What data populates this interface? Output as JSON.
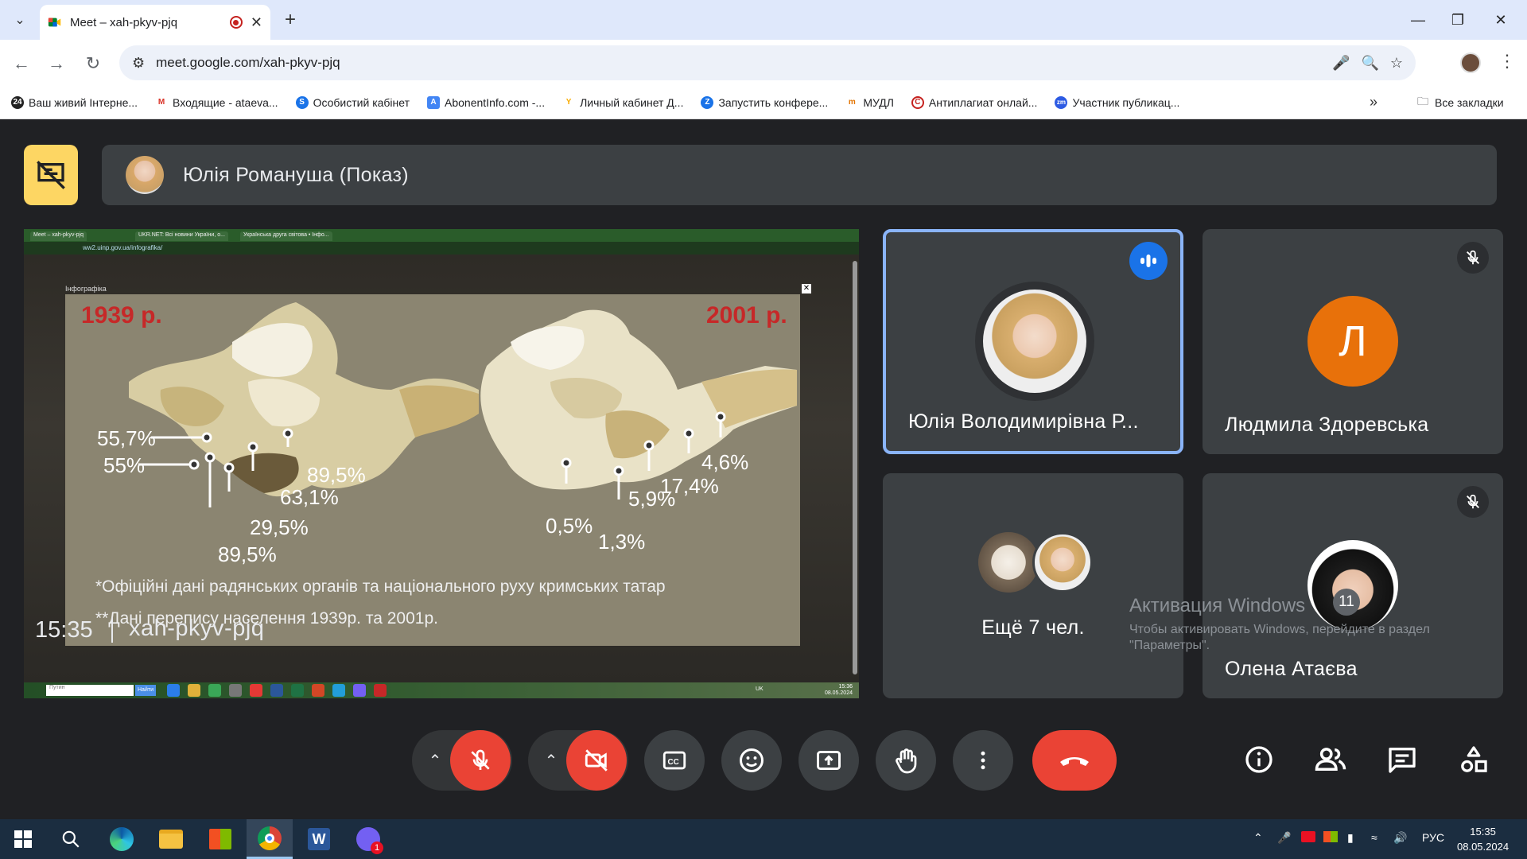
{
  "browser": {
    "tab_title": "Meet – xah-pkyv-pjq",
    "url": "meet.google.com/xah-pkyv-pjq",
    "new_tab_symbol": "+",
    "window_controls": [
      "minimize",
      "restore",
      "close"
    ]
  },
  "bookmarks": [
    {
      "label": "Ваш живий Інтерне...",
      "color": "#222",
      "glyph": "24"
    },
    {
      "label": "Входящие - ataeva...",
      "color": "#d93025",
      "glyph": "M"
    },
    {
      "label": "Особистий кабінет",
      "color": "#1a73e8",
      "glyph": "S"
    },
    {
      "label": "AbonentInfo.com -...",
      "color": "#4285f4",
      "glyph": "A"
    },
    {
      "label": "Личный кабинет Д...",
      "color": "#f9ab00",
      "glyph": "Y"
    },
    {
      "label": "Запустить конфере...",
      "color": "#1a73e8",
      "glyph": "Z"
    },
    {
      "label": "МУДЛ",
      "color": "#e37400",
      "glyph": "m"
    },
    {
      "label": "Антиплагиат онлай...",
      "color": "#c5221f",
      "glyph": "C"
    },
    {
      "label": "Участник публикац...",
      "color": "#2d5be3",
      "glyph": "zm"
    }
  ],
  "bookmarks_all": "Все закладки",
  "presenter": {
    "name": "Юлія Романуша (Показ)"
  },
  "shared_screen": {
    "inner_tabs": [
      "Meet – xah-pkyv-pjq",
      "UKR.NET: Всі новини України, о...",
      "Українська друга світова • Інфо..."
    ],
    "inner_url": "ww2.uinp.gov.ua/infografika/",
    "infographic_label": "Інфографіка",
    "year_left": "1939 р.",
    "year_right": "2001 р.",
    "left_values": [
      "55,7%",
      "55%",
      "89,5%",
      "63,1%",
      "29,5%",
      "89,5%"
    ],
    "right_values": [
      "4,6%",
      "17,4%",
      "5,9%",
      "0,5%",
      "1,3%"
    ],
    "note1": "*Офіційні дані радянських органів та національного руху кримських татар",
    "note2": "**Дані перепису населення 1939р. та 2001р.",
    "inner_search": "Путин",
    "inner_search_btn": "Найти",
    "inner_lang": "UK",
    "inner_time": "15:36",
    "inner_date": "08.05.2024"
  },
  "tiles": [
    {
      "name": "Юлія Володимирівна Р...",
      "state": "speaking"
    },
    {
      "name": "Людмила Здоревська",
      "avatar_letter": "Л",
      "state": "muted"
    },
    {
      "name": "Ещё 7 чел."
    },
    {
      "name": "Олена Атаєва",
      "state": "muted"
    }
  ],
  "meeting": {
    "time": "15:35",
    "code": "xah-pkyv-pjq"
  },
  "controls": [
    "mic-off",
    "camera-off",
    "captions",
    "reactions",
    "present",
    "raise-hand",
    "more-options",
    "leave-call"
  ],
  "right_controls": [
    "info",
    "people",
    "chat",
    "activities"
  ],
  "participant_count": "11",
  "activation": {
    "title": "Активация Windows",
    "line1": "Чтобы активировать Windows, перейдите в раздел",
    "line2": "\"Параметры\"."
  },
  "taskbar": {
    "lang": "РУС",
    "time": "15:35",
    "date": "08.05.2024",
    "viber_badge": "1"
  }
}
